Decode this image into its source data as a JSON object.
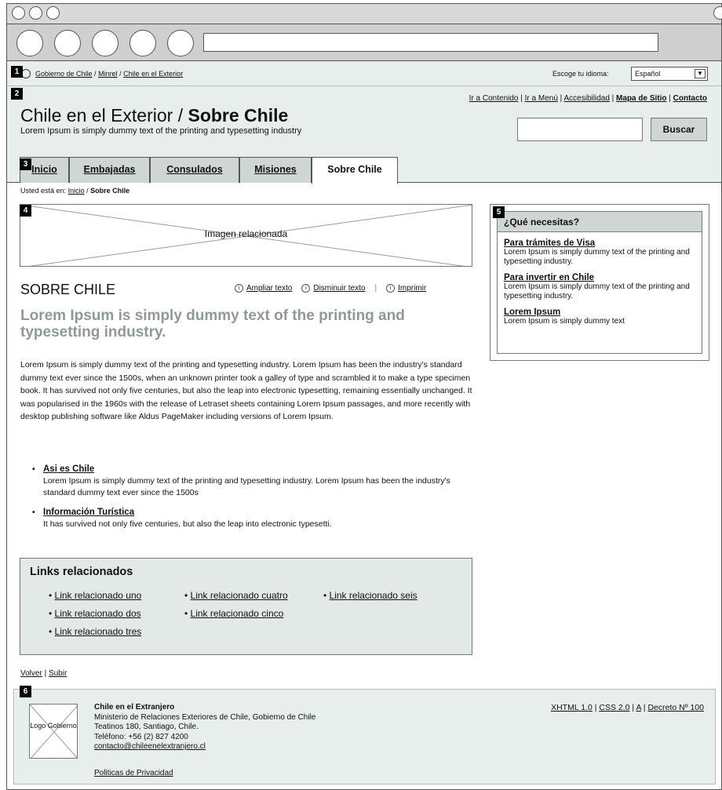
{
  "browser": {},
  "callouts": [
    "1",
    "2",
    "3",
    "4",
    "5",
    "6"
  ],
  "top": {
    "crumbs": [
      "Gobierno de Chile",
      "Minrel",
      "Chile en el Exterior"
    ],
    "lang_label": "Escoge tu idioma:",
    "lang_value": "Español"
  },
  "header": {
    "util_links": [
      "Ir a Contenido",
      "Ir a Menú",
      "Accesibilidad",
      "Mapa de Sitio",
      "Contacto"
    ],
    "title_plain": "Chile en el Exterior / ",
    "title_bold": "Sobre Chile",
    "tagline": "Lorem Ipsum is simply dummy text of the printing and typesetting industry",
    "search_button": "Buscar"
  },
  "tabs": [
    "Inicio",
    "Embajadas",
    "Consulados",
    "Misiones",
    "Sobre Chile"
  ],
  "breadcrumb": {
    "prefix": "Usted está en:",
    "home": "Inicio",
    "current": "Sobre Chile"
  },
  "related_image": "Imagen relacionada",
  "article": {
    "title": "SOBRE CHILE",
    "tools": [
      "Ampliar texto",
      "Disminuir texto",
      "Imprimir"
    ],
    "lead": "Lorem Ipsum is simply dummy text of the printing and typesetting industry.",
    "body": "Lorem Ipsum is simply dummy text of the printing and typesetting industry. Lorem Ipsum has been the industry's standard dummy text ever since the 1500s, when an unknown printer took a galley of type and scrambled it to make a type specimen book. It has survived not only five centuries, but also the leap into electronic typesetting, remaining essentially unchanged. It was popularised in the 1960s with the release of Letraset sheets containing Lorem Ipsum passages, and more recently with desktop publishing software like Aldus PageMaker including versions of Lorem Ipsum.",
    "bullets": [
      {
        "title": "Asi es Chile",
        "text": "Lorem Ipsum is simply dummy text of the printing and typesetting industry. Lorem Ipsum has been the industry's standard dummy text ever since the 1500s"
      },
      {
        "title": "Información Turística",
        "text": "It has survived not only five centuries, but also the leap into electronic typesetti."
      }
    ]
  },
  "related_links": {
    "title": "Links relacionados",
    "links": [
      "Link relacionado uno",
      "Link relacionado dos",
      "Link relacionado tres",
      "Link relacionado cuatro",
      "Link relacionado cinco",
      "Link relacionado seis"
    ]
  },
  "page_nav": [
    "Volver",
    "Subir"
  ],
  "sidebar": {
    "title": "¿Qué necesitas?",
    "items": [
      {
        "title": "Para trámites de Visa",
        "text": "Lorem Ipsum is simply dummy text of the printing and typesetting industry."
      },
      {
        "title": "Para invertir en Chile",
        "text": "Lorem Ipsum is simply dummy text of the printing and typesetting industry."
      },
      {
        "title": "Lorem Ipsum",
        "text": "Lorem Ipsum is simply dummy text"
      }
    ]
  },
  "footer": {
    "logo_text": "Logo Gobierno",
    "name": "Chile en el Extranjero",
    "lines": [
      "Ministerio de Relaciones Exteriores de Chile, Gobierno de Chile",
      "Teatinos 180, Santiago, Chile.",
      "Teléfono: +56 (2) 827 4200"
    ],
    "email": "contacto@chileenelextranjero.cl",
    "privacy": "Politicas de Privacidad",
    "standards": [
      "XHTML 1.0",
      "CSS 2.0",
      "A",
      "Decreto Nº 100"
    ]
  }
}
